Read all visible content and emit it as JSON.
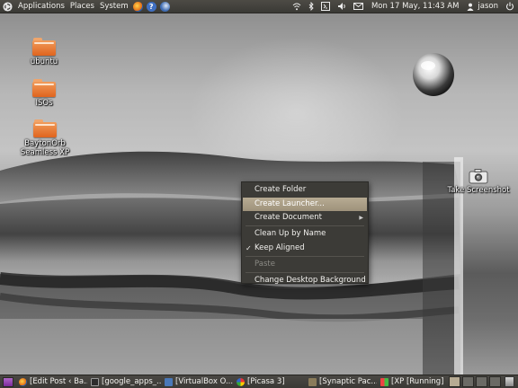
{
  "top_panel": {
    "menus": [
      "Applications",
      "Places",
      "System"
    ],
    "clock": "Mon 17 May, 11:43 AM",
    "user": "jason"
  },
  "desktop_icons": [
    {
      "label": "ubuntu"
    },
    {
      "label": "ISOs"
    },
    {
      "label": "BaytonOrb Seamless XP"
    },
    {
      "label": "Take Screenshot"
    }
  ],
  "context_menu": {
    "items": [
      {
        "label": "Create Folder"
      },
      {
        "label": "Create Launcher..."
      },
      {
        "label": "Create Document"
      },
      {
        "label": "Clean Up by Name"
      },
      {
        "label": "Keep Aligned",
        "checked": true
      },
      {
        "label": "Paste",
        "disabled": true
      },
      {
        "label": "Change Desktop Background"
      }
    ]
  },
  "taskbar": {
    "tasks": [
      {
        "label": "[Edit Post ‹ Ba...",
        "icon": "firefox-icon"
      },
      {
        "label": "[google_apps_...",
        "icon": "terminal-icon"
      },
      {
        "label": "[VirtualBox O...",
        "icon": "virtualbox-icon"
      },
      {
        "label": "[Picasa 3]",
        "icon": "picasa-icon"
      },
      {
        "label": "[Synaptic Pac...",
        "icon": "synaptic-icon"
      },
      {
        "label": "[XP [Running] ...",
        "icon": "vm-icon"
      }
    ]
  },
  "colors": {
    "panel": "#3c3b37",
    "menu_highlight": "#b7ab93",
    "folder_orange": "#e86f25"
  }
}
